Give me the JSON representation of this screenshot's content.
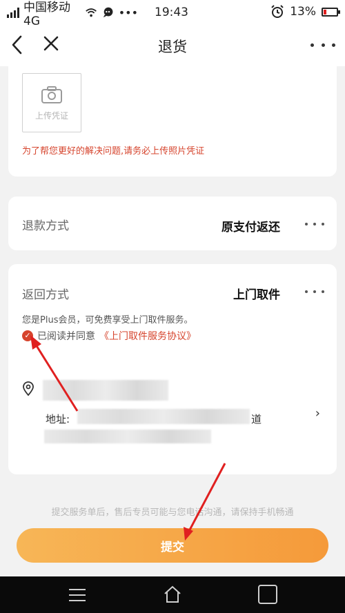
{
  "status_bar": {
    "carrier": "中国移动4G",
    "time": "19:43",
    "battery": "13%"
  },
  "nav": {
    "title": "退货"
  },
  "upload": {
    "label": "上传凭证",
    "warning": "为了帮您更好的解决问题,请务必上传照片凭证"
  },
  "refund": {
    "label": "退款方式",
    "value": "原支付返还"
  },
  "return": {
    "label": "返回方式",
    "value": "上门取件",
    "plus_note": "您是Plus会员，可免费享受上门取件服务。",
    "agree_text": "已阅读并同意",
    "agree_link": "《上门取件服务协议》",
    "address_label": "地址:",
    "address_tail": "道"
  },
  "footer": {
    "note": "提交服务单后，售后专员可能与您电话沟通，请保持手机畅通",
    "submit": "提交"
  },
  "colors": {
    "accent": "#f59a3a",
    "warning_red": "#d6442d",
    "annotation_red": "#e02020"
  }
}
